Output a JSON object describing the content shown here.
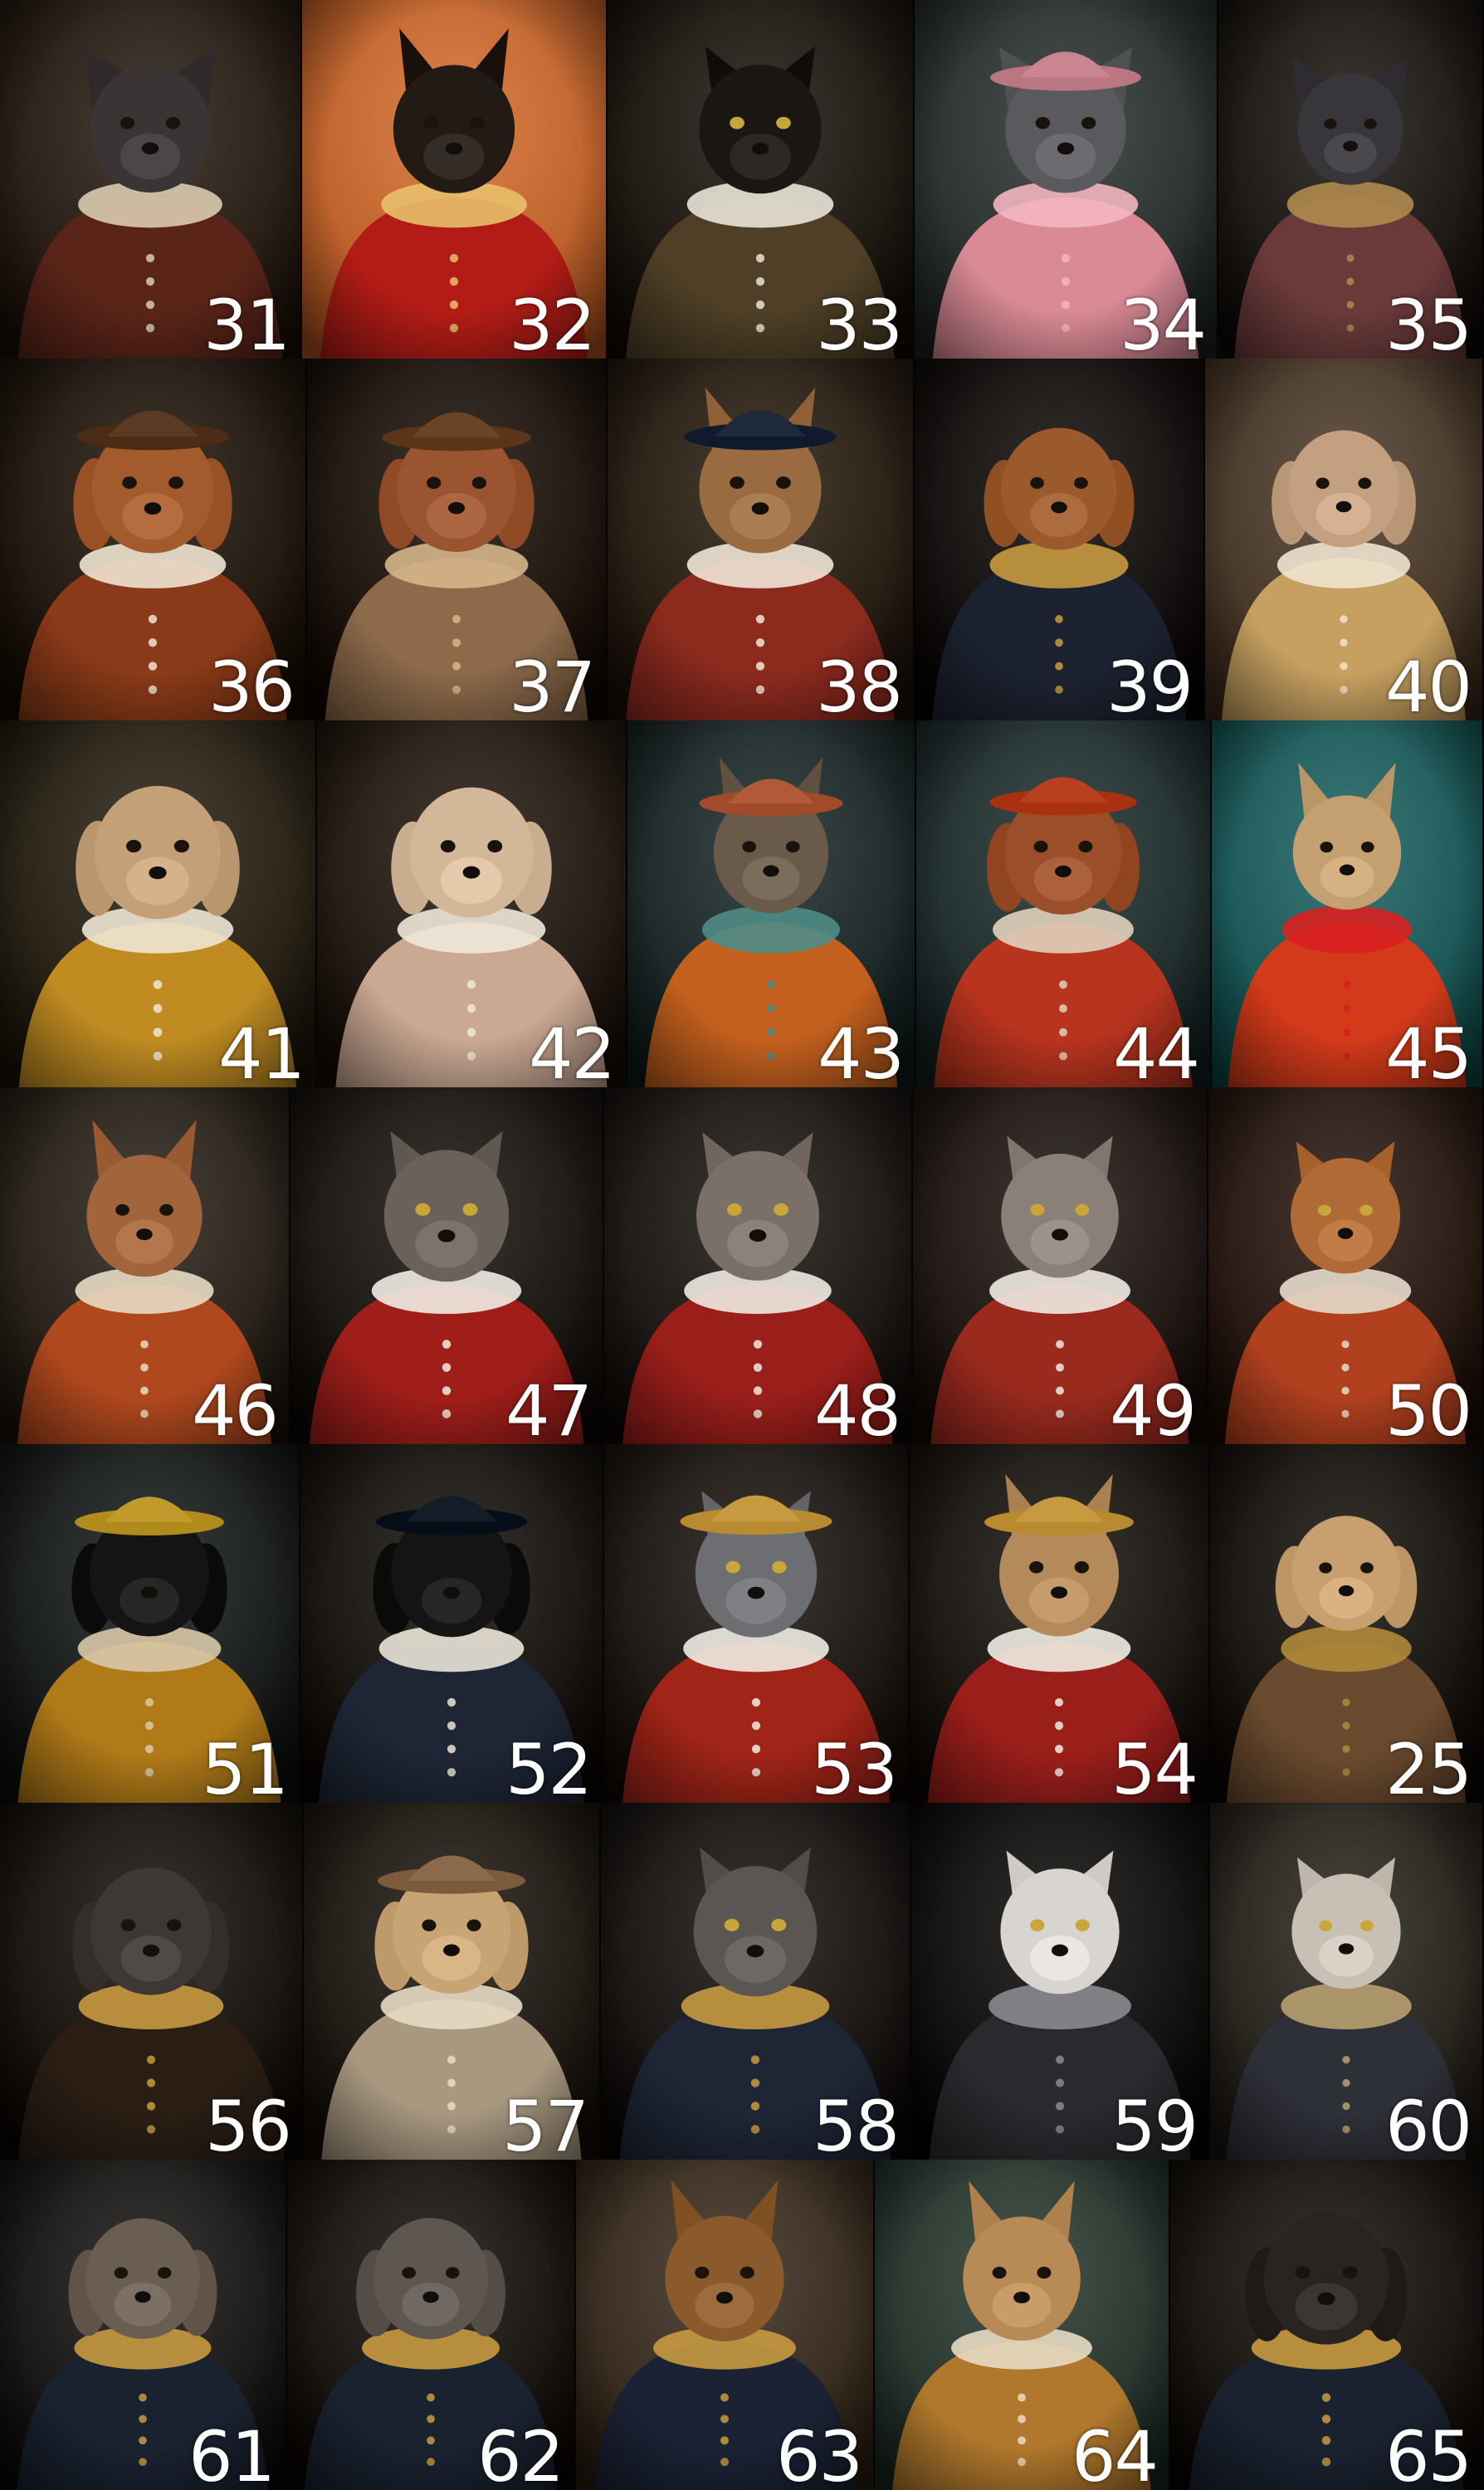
{
  "rows": [
    {
      "tiles": [
        {
          "number": "31",
          "subject": "dog",
          "bg": "#2a2018",
          "coat": "#5a2418",
          "fur": "#3a3534",
          "hat": null,
          "accent": "#d9cbb0",
          "ears": "bat"
        },
        {
          "number": "32",
          "subject": "dog",
          "bg": "#c0642e",
          "coat": "#b31c16",
          "fur": "#221a14",
          "hat": null,
          "accent": "#e7c06a",
          "ears": "tall"
        },
        {
          "number": "33",
          "subject": "cat",
          "bg": "#201a14",
          "coat": "#4e3f26",
          "fur": "#1a1614",
          "hat": null,
          "accent": "#e9e4d8",
          "ears": "cat"
        },
        {
          "number": "34",
          "subject": "dog",
          "bg": "#2c3330",
          "coat": "#d98a95",
          "fur": "#5a5a5e",
          "hat": "#c98690",
          "accent": "#f3b6c0",
          "ears": "bat"
        },
        {
          "number": "35",
          "subject": "dog",
          "bg": "#1e1a16",
          "coat": "#6a3a3a",
          "fur": "#38363a",
          "hat": null,
          "accent": "#b0894e",
          "ears": "bat"
        }
      ]
    },
    {
      "tiles": [
        {
          "number": "36",
          "subject": "dog",
          "bg": "#231a12",
          "coat": "#8a3a18",
          "fur": "#a35a2c",
          "hat": "#5a3a22",
          "accent": "#eee4d2",
          "ears": "flop"
        },
        {
          "number": "37",
          "subject": "dog",
          "bg": "#20170f",
          "coat": "#8c6a4a",
          "fur": "#9a5430",
          "hat": "#6b4326",
          "accent": "#d6b68a",
          "ears": "flop"
        },
        {
          "number": "38",
          "subject": "dog",
          "bg": "#2a2016",
          "coat": "#8c2a1e",
          "fur": "#9a6a40",
          "hat": "#1e2a3c",
          "accent": "#efe6d6",
          "ears": "tall"
        },
        {
          "number": "39",
          "subject": "dog",
          "bg": "#16120e",
          "coat": "#1c2230",
          "fur": "#9a5a2c",
          "hat": null,
          "accent": "#c89a40",
          "ears": "flop"
        },
        {
          "number": "40",
          "subject": "dog",
          "bg": "#4a3a2c",
          "coat": "#c6a060",
          "fur": "#c2a080",
          "hat": null,
          "accent": "#efe4d0",
          "ears": "flop"
        }
      ]
    },
    {
      "tiles": [
        {
          "number": "41",
          "subject": "dog",
          "bg": "#2a2418",
          "coat": "#c08c22",
          "fur": "#c4a078",
          "hat": null,
          "accent": "#efe6d4",
          "ears": "flop"
        },
        {
          "number": "42",
          "subject": "dog",
          "bg": "#261d16",
          "coat": "#caa892",
          "fur": "#d2b898",
          "hat": null,
          "accent": "#f0e8da",
          "ears": "flop"
        },
        {
          "number": "43",
          "subject": "dog",
          "bg": "#1f2a2a",
          "coat": "#c4601e",
          "fur": "#6a5a4a",
          "hat": "#b05a3a",
          "accent": "#4e8c86",
          "ears": "tall"
        },
        {
          "number": "44",
          "subject": "dog",
          "bg": "#233030",
          "coat": "#b8341e",
          "fur": "#9a4e2a",
          "hat": "#b84020",
          "accent": "#e0d2bc",
          "ears": "flop"
        },
        {
          "number": "45",
          "subject": "dog",
          "bg": "#1e5a5a",
          "coat": "#d23a1a",
          "fur": "#c4a070",
          "hat": null,
          "accent": "#d82020",
          "ears": "tall"
        }
      ]
    },
    {
      "tiles": [
        {
          "number": "46",
          "subject": "dog",
          "bg": "#2a241c",
          "coat": "#b0481e",
          "fur": "#a2643a",
          "hat": null,
          "accent": "#e8dcc4",
          "ears": "tall"
        },
        {
          "number": "47",
          "subject": "cat",
          "bg": "#1c1814",
          "coat": "#a01e1a",
          "fur": "#6a625a",
          "hat": null,
          "accent": "#f0ece4",
          "ears": "cat"
        },
        {
          "number": "48",
          "subject": "cat",
          "bg": "#1e1a16",
          "coat": "#9a1e1a",
          "fur": "#7a7068",
          "hat": null,
          "accent": "#eeeae2",
          "ears": "cat"
        },
        {
          "number": "49",
          "subject": "cat",
          "bg": "#221a16",
          "coat": "#9a2a1e",
          "fur": "#8a8078",
          "hat": null,
          "accent": "#eeeae2",
          "ears": "cat"
        },
        {
          "number": "50",
          "subject": "cat",
          "bg": "#2a1c14",
          "coat": "#b0401e",
          "fur": "#b06a36",
          "hat": null,
          "accent": "#e6dccc",
          "ears": "cat"
        }
      ]
    },
    {
      "tiles": [
        {
          "number": "51",
          "subject": "dog",
          "bg": "#1a1e1c",
          "coat": "#b07a18",
          "fur": "#141414",
          "hat": "#c09a2a",
          "accent": "#d8c8a8",
          "ears": "flop"
        },
        {
          "number": "52",
          "subject": "dog",
          "bg": "#1a1612",
          "coat": "#1e2636",
          "fur": "#141414",
          "hat": "#141c28",
          "accent": "#eae4d8",
          "ears": "flop"
        },
        {
          "number": "53",
          "subject": "cat",
          "bg": "#201a16",
          "coat": "#a02418",
          "fur": "#6c6e72",
          "hat": "#c89a40",
          "accent": "#f0ece4",
          "ears": "cat"
        },
        {
          "number": "54",
          "subject": "dog",
          "bg": "#1c1814",
          "coat": "#9a1e1a",
          "fur": "#b48a5a",
          "hat": "#c89a40",
          "accent": "#f0ece4",
          "ears": "tall"
        },
        {
          "number": "25",
          "subject": "dog",
          "bg": "#1a1612",
          "coat": "#6a4a2e",
          "fur": "#c8a070",
          "hat": null,
          "accent": "#b08a3a",
          "ears": "flop"
        }
      ]
    },
    {
      "tiles": [
        {
          "number": "56",
          "subject": "dog",
          "bg": "#1a1612",
          "coat": "#2a1e14",
          "fur": "#3e3834",
          "hat": null,
          "accent": "#c89a40",
          "ears": "flop"
        },
        {
          "number": "57",
          "subject": "dog",
          "bg": "#221c16",
          "coat": "#a89880",
          "fur": "#c8a474",
          "hat": "#8a6a4a",
          "accent": "#e8dcc4",
          "ears": "flop"
        },
        {
          "number": "58",
          "subject": "cat",
          "bg": "#1a1714",
          "coat": "#1e2636",
          "fur": "#5a5654",
          "hat": null,
          "accent": "#c89a40",
          "ears": "cat"
        },
        {
          "number": "59",
          "subject": "cat",
          "bg": "#141210",
          "coat": "#2a2a2e",
          "fur": "#d8d4d0",
          "hat": null,
          "accent": "#8a8a90",
          "ears": "cat"
        },
        {
          "number": "60",
          "subject": "cat",
          "bg": "#2a2620",
          "coat": "#2e3038",
          "fur": "#c8c0b4",
          "hat": null,
          "accent": "#b8a070",
          "ears": "cat"
        }
      ]
    },
    {
      "tiles": [
        {
          "number": "61",
          "subject": "dog",
          "bg": "#1c1a18",
          "coat": "#1a2230",
          "fur": "#6a5e52",
          "hat": null,
          "accent": "#c89a40",
          "ears": "flop"
        },
        {
          "number": "62",
          "subject": "dog",
          "bg": "#1a1612",
          "coat": "#1a2230",
          "fur": "#5e5650",
          "hat": null,
          "accent": "#c89a40",
          "ears": "flop"
        },
        {
          "number": "63",
          "subject": "dog",
          "bg": "#3a2e22",
          "coat": "#1a2234",
          "fur": "#8a5a2c",
          "hat": null,
          "accent": "#c89a40",
          "ears": "tall"
        },
        {
          "number": "64",
          "subject": "dog",
          "bg": "#2a3830",
          "coat": "#b0782c",
          "fur": "#b88a56",
          "hat": null,
          "accent": "#e8dcc4",
          "ears": "tall"
        },
        {
          "number": "65",
          "subject": "dog",
          "bg": "#1a1612",
          "coat": "#1a2230",
          "fur": "#2a2420",
          "hat": null,
          "accent": "#c89a40",
          "ears": "flop"
        }
      ]
    }
  ]
}
